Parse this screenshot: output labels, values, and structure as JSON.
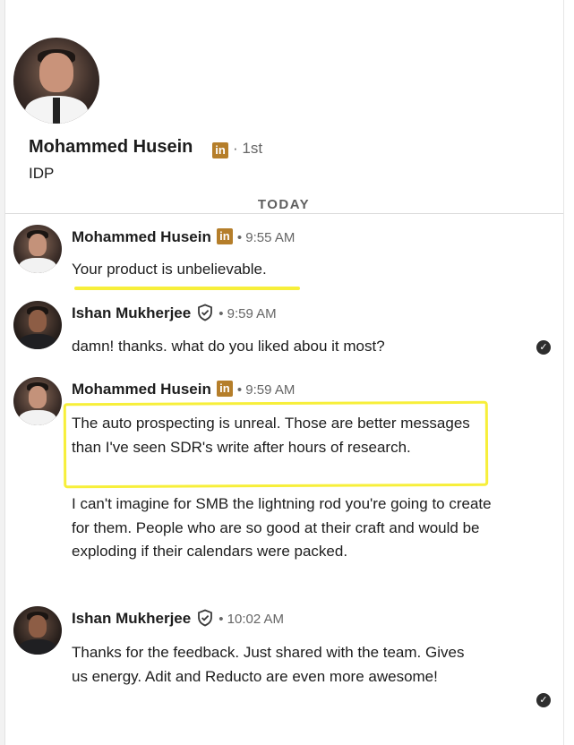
{
  "profile": {
    "name": "Mohammed Husein",
    "badge": "in",
    "degree": "· 1st",
    "headline": "IDP"
  },
  "day_divider": "TODAY",
  "messages": [
    {
      "sender": "Mohammed Husein",
      "badge": "in",
      "time": "• 9:55 AM",
      "paragraphs": [
        "Your product is unbelievable."
      ],
      "read": false
    },
    {
      "sender": "Ishan Mukherjee",
      "time": "• 9:59 AM",
      "paragraphs": [
        "damn! thanks. what do you liked abou it most?"
      ],
      "read": true
    },
    {
      "sender": "Mohammed Husein",
      "badge": "in",
      "time": "• 9:59 AM",
      "paragraphs": [
        "The auto prospecting is unreal. Those are better messages than I've seen SDR's write after hours of research.",
        "I can't imagine for SMB the lightning rod you're going to create for them. People who are so good at their craft and would be exploding if their calendars were packed."
      ],
      "read": false
    },
    {
      "sender": "Ishan Mukherjee",
      "time": "• 10:02 AM",
      "paragraphs": [
        "Thanks for the feedback. Just shared with the team. Gives us energy. Adit and Reducto are even more awesome!"
      ],
      "read": true
    }
  ],
  "colors": {
    "linkedin_badge": "#b57e2a",
    "highlight": "#f7ef3a",
    "text": "#1d1d1d",
    "muted": "#666666"
  }
}
